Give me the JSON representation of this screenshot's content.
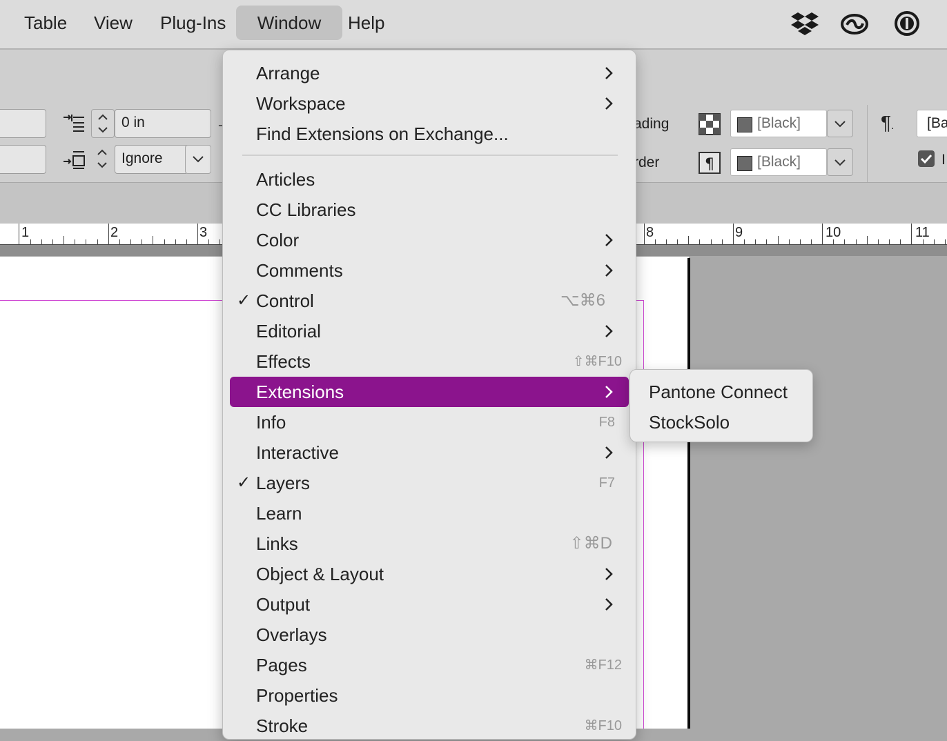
{
  "menubar": {
    "items": [
      "Table",
      "View",
      "Plug-Ins",
      "Window",
      "Help"
    ],
    "active": "Window",
    "tray_icons": [
      "dropbox-icon",
      "creative-cloud-icon",
      "1password-icon"
    ]
  },
  "control_panel": {
    "space_before": "0 in",
    "align_to_grid": "Ignore",
    "fill_label_partial": "ading",
    "stroke_label_partial": "rder",
    "fill_color": "[Black]",
    "stroke_color": "[Black]",
    "paragraph_style_partial": "[Ba"
  },
  "ruler": {
    "labels": [
      "1",
      "2",
      "3",
      "8",
      "9",
      "10",
      "11"
    ]
  },
  "window_menu": {
    "items": [
      {
        "label": "Arrange",
        "submenu": true
      },
      {
        "label": "Workspace",
        "submenu": true
      },
      {
        "label": "Find Extensions on Exchange..."
      },
      {
        "label": "Articles"
      },
      {
        "label": "CC Libraries"
      },
      {
        "label": "Color",
        "submenu": true
      },
      {
        "label": "Comments",
        "submenu": true
      },
      {
        "label": "Control",
        "checked": true,
        "shortcut": "⌥⌘6"
      },
      {
        "label": "Editorial",
        "submenu": true
      },
      {
        "label": "Effects",
        "shortcut": "⇧⌘F10"
      },
      {
        "label": "Extensions",
        "submenu": true,
        "highlighted": true
      },
      {
        "label": "Info",
        "shortcut": "F8"
      },
      {
        "label": "Interactive",
        "submenu": true
      },
      {
        "label": "Layers",
        "checked": true,
        "shortcut": "F7"
      },
      {
        "label": "Learn"
      },
      {
        "label": "Links",
        "shortcut": "⇧⌘D"
      },
      {
        "label": "Object & Layout",
        "submenu": true
      },
      {
        "label": "Output",
        "submenu": true
      },
      {
        "label": "Overlays"
      },
      {
        "label": "Pages",
        "shortcut": "⌘F12"
      },
      {
        "label": "Properties"
      },
      {
        "label": "Stroke",
        "shortcut": "⌘F10"
      }
    ],
    "check_mark": "✓"
  },
  "extensions_submenu": {
    "items": [
      "Pantone Connect",
      "StockSolo"
    ]
  },
  "colors": {
    "highlight": "#8b148d",
    "margin_guide": "#d04ad4"
  }
}
